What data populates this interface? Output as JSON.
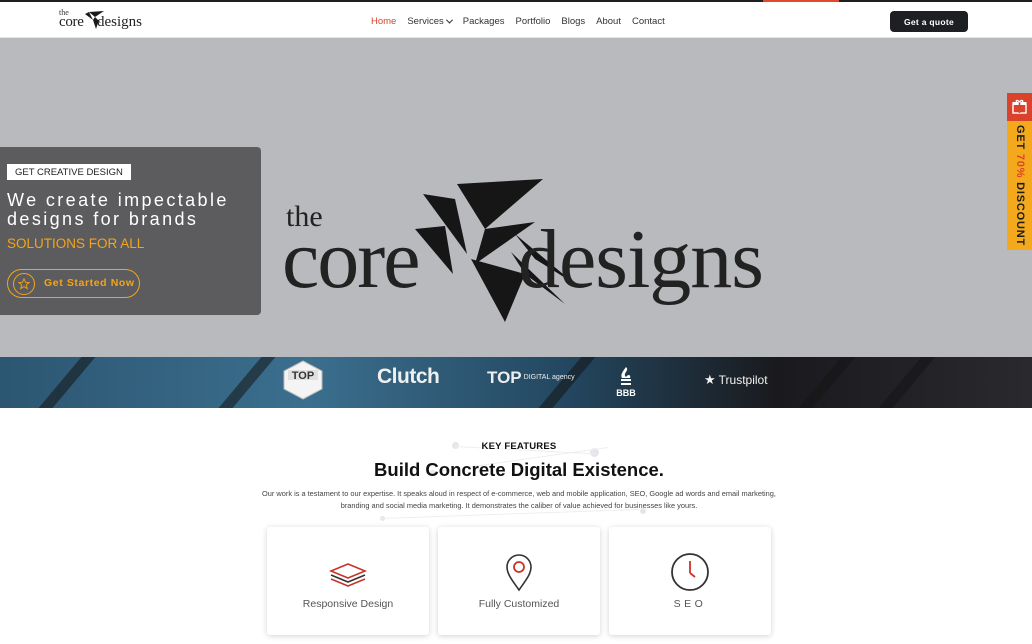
{
  "header": {
    "logo": {
      "the": "the",
      "core": "core",
      "designs": "designs"
    },
    "nav": [
      {
        "label": "Home",
        "active": true
      },
      {
        "label": "Services",
        "has_dropdown": true
      },
      {
        "label": "Packages"
      },
      {
        "label": "Portfolio"
      },
      {
        "label": "Blogs"
      },
      {
        "label": "About"
      },
      {
        "label": "Contact"
      }
    ],
    "quote_button": "Get a quote"
  },
  "hero": {
    "tag": "GET CREATIVE DESIGN",
    "heading": "We create impectable designs for brands",
    "subheading": "SOLUTIONS FOR ALL",
    "cta": "Get Started Now",
    "big_logo": {
      "the": "the",
      "core": "core",
      "designs": "designs"
    }
  },
  "side_tab": {
    "prefix": "GET",
    "percent": "70%",
    "suffix": "DISCOUNT",
    "icon": "gift-icon"
  },
  "badges": {
    "top": "TOP",
    "clutch": "Clutch",
    "top_digital": "TOP",
    "top_digital_small": "DIGITAL agency",
    "bbb": "BBB",
    "trustpilot": "Trustpilot"
  },
  "features": {
    "label": "KEY FEATURES",
    "title": "Build Concrete Digital Existence.",
    "description": "Our work is a testament to our expertise. It speaks aloud in respect of e-commerce, web and mobile application, SEO, Google ad words and email marketing, branding and social media marketing. It demonstrates the caliber of value achieved for businesses like yours.",
    "cards": [
      {
        "label": "Responsive Design",
        "icon": "layers-icon"
      },
      {
        "label": "Fully Customized",
        "icon": "location-pin-icon"
      },
      {
        "label": "SEO",
        "icon": "clock-icon"
      }
    ]
  },
  "colors": {
    "accent_red": "#d9432b",
    "accent_orange": "#f2a51a",
    "dark": "#1d1f23",
    "hero_bg": "#b9babd"
  }
}
